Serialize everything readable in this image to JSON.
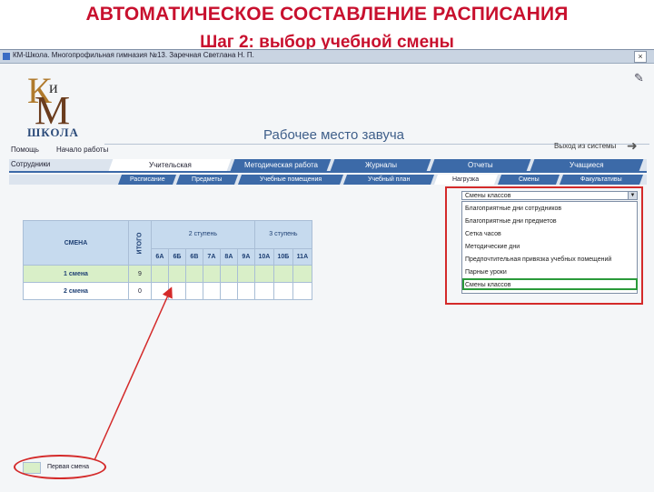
{
  "slide": {
    "title": "АВТОМАТИЧЕСКОЕ СОСТАВЛЕНИЕ РАСПИСАНИЯ",
    "subtitle": "Шаг 2: выбор учебной смены"
  },
  "window": {
    "title": "КМ-Школа. Многопрофильная гимназия №13. Заречная Светлана Н. П.",
    "close": "×"
  },
  "logo": {
    "k": "К",
    "i": "и",
    "m": "М",
    "school": "ШКОЛА"
  },
  "header": {
    "workspace": "Рабочее место завуча",
    "help": "Помощь",
    "start": "Начало работы",
    "logout": "Выход из системы",
    "logout_arrow": "➜",
    "edit_icon": "✎"
  },
  "main_nav": {
    "label": "Сотрудники",
    "tabs": [
      "Учительская",
      "Методическая работа",
      "Журналы",
      "Отчеты",
      "Учащиеся"
    ]
  },
  "sub_nav": {
    "tabs": [
      "Расписание",
      "Предметы",
      "Учебные помещения",
      "Учебный план",
      "Нагрузка",
      "Смены",
      "Факультативы"
    ]
  },
  "grid": {
    "shift_header": "СМЕНА",
    "total_header": "ИТОГО",
    "groups": [
      "2 ступень",
      "3 ступень"
    ],
    "classes": [
      "6А",
      "6Б",
      "6В",
      "7А",
      "8А",
      "9А",
      "10А",
      "10Б",
      "11А"
    ],
    "rows": [
      {
        "label": "1 смена",
        "total": "9"
      },
      {
        "label": "2 смена",
        "total": "0"
      }
    ]
  },
  "dropdown": {
    "selected": "Смены классов",
    "options": [
      "Благоприятные дни сотрудников",
      "Благоприятные дни предметов",
      "Сетка часов",
      "Методические дни",
      "Предпочтительная привязка учебных помещений",
      "Парные уроки",
      "Смены классов"
    ]
  },
  "legend": {
    "text": "Первая смена"
  }
}
